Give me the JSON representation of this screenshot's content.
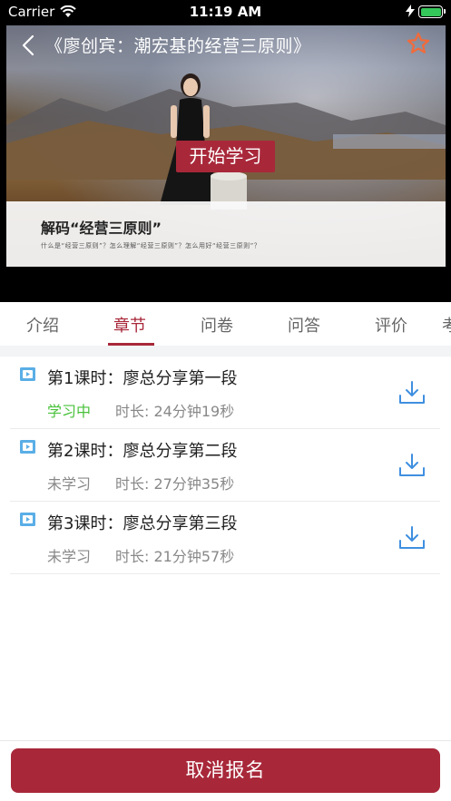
{
  "status_bar": {
    "carrier": "Carrier",
    "time": "11:19 AM"
  },
  "header": {
    "title": "《廖创宾：潮宏基的经营三原则》",
    "start_button": "开始学习",
    "cover_heading": "解码“经营三原则”",
    "cover_subtitle": "什么是“经营三原则”？怎么理解“经营三原则”？怎么用好“经营三原则”？"
  },
  "tabs": [
    {
      "label": "介绍",
      "active": false
    },
    {
      "label": "章节",
      "active": true
    },
    {
      "label": "问卷",
      "active": false
    },
    {
      "label": "问答",
      "active": false
    },
    {
      "label": "评价",
      "active": false
    },
    {
      "label": "考",
      "active": false
    }
  ],
  "lessons": [
    {
      "title": "第1课时：廖总分享第一段",
      "status": "学习中",
      "duration": "时长: 24分钟19秒"
    },
    {
      "title": "第2课时：廖总分享第二段",
      "status": "未学习",
      "duration": "时长: 27分钟35秒"
    },
    {
      "title": "第3课时：廖总分享第三段",
      "status": "未学习",
      "duration": "时长: 21分钟57秒"
    }
  ],
  "footer": {
    "cancel_button": "取消报名"
  },
  "colors": {
    "accent": "#a8283a",
    "studying": "#48c23a",
    "download": "#3f8fe0",
    "star": "#f26a3a"
  }
}
